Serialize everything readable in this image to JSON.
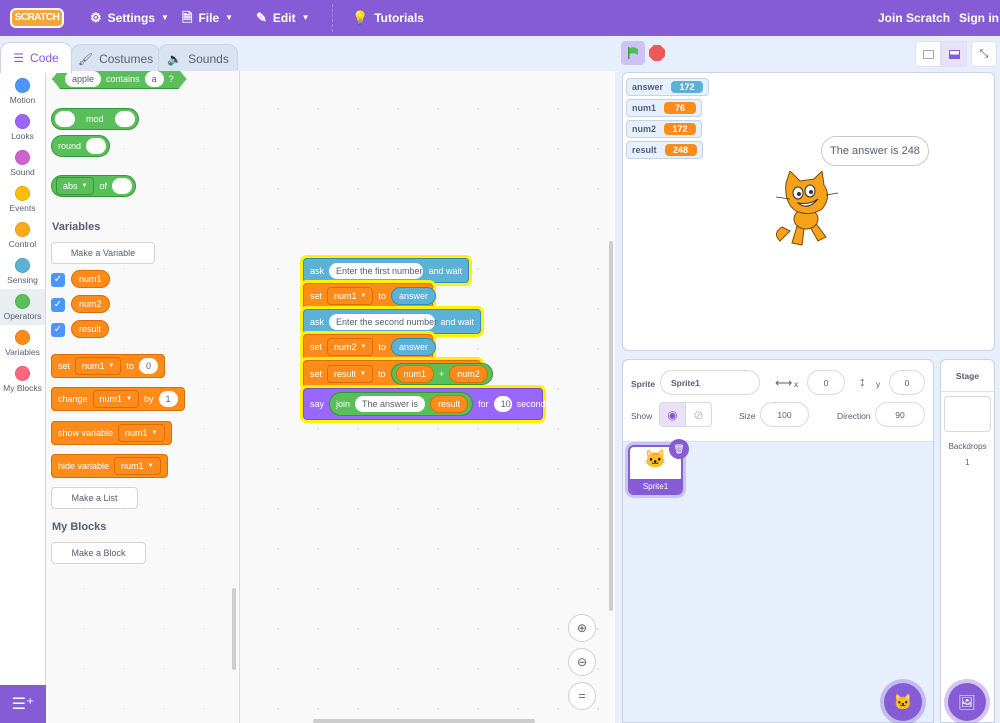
{
  "menubar": {
    "logo": "SCRATCH",
    "settings": "Settings",
    "file": "File",
    "edit": "Edit",
    "tutorials": "Tutorials",
    "join": "Join Scratch",
    "signin": "Sign in"
  },
  "tabs": [
    {
      "label": "Code",
      "active": true
    },
    {
      "label": "Costumes"
    },
    {
      "label": "Sounds"
    }
  ],
  "categories": [
    {
      "label": "Motion",
      "color": "#4c97ff"
    },
    {
      "label": "Looks",
      "color": "#9966ff"
    },
    {
      "label": "Sound",
      "color": "#cf63cf"
    },
    {
      "label": "Events",
      "color": "#ffbf00"
    },
    {
      "label": "Control",
      "color": "#ffab19"
    },
    {
      "label": "Sensing",
      "color": "#5cb1d6"
    },
    {
      "label": "Operators",
      "color": "#59c059"
    },
    {
      "label": "Variables",
      "color": "#ff8c1a"
    },
    {
      "label": "My Blocks",
      "color": "#ff6680"
    }
  ],
  "palette": {
    "contains": {
      "a": "apple",
      "word": "contains",
      "b": "a",
      "q": "?"
    },
    "mod": "mod",
    "round": "round",
    "abs": {
      "fn": "abs",
      "of": "of"
    },
    "variables_heading": "Variables",
    "make_variable": "Make a Variable",
    "vars": [
      "num1",
      "num2",
      "result"
    ],
    "set": {
      "word": "set",
      "var": "num1",
      "to": "to",
      "value": "0"
    },
    "change": {
      "word": "change",
      "var": "num1",
      "by": "by",
      "value": "1"
    },
    "show_variable": {
      "word": "show variable",
      "var": "num1"
    },
    "hide_variable": {
      "word": "hide variable",
      "var": "num1"
    },
    "make_list": "Make a List",
    "myblocks_heading": "My Blocks",
    "make_block": "Make a Block"
  },
  "script": {
    "ask1": {
      "word": "ask",
      "text": "Enter the first number",
      "tail": "and wait"
    },
    "set1": {
      "word": "set",
      "var": "num1",
      "to": "to",
      "value": "answer"
    },
    "ask2": {
      "word": "ask",
      "text": "Enter the second number",
      "tail": "and wait"
    },
    "set2": {
      "word": "set",
      "var": "num2",
      "to": "to",
      "value": "answer"
    },
    "set3": {
      "word": "set",
      "var": "result",
      "to": "to",
      "a": "num1",
      "op": "+",
      "b": "num2"
    },
    "say": {
      "word": "say",
      "join": "join",
      "text": "The answer is",
      "var": "result",
      "for": "for",
      "secs": "10",
      "unit": "seconds"
    }
  },
  "monitors": [
    {
      "name": "answer",
      "value": "172",
      "color": "#5cb1d6"
    },
    {
      "name": "num1",
      "value": "76",
      "color": "#ff8c1a"
    },
    {
      "name": "num2",
      "value": "172",
      "color": "#ff8c1a"
    },
    {
      "name": "result",
      "value": "248",
      "color": "#ff8c1a"
    }
  ],
  "speech": "The answer is 248",
  "sprite_info": {
    "sprite_label": "Sprite",
    "sprite_name": "Sprite1",
    "x_label": "x",
    "x": "0",
    "y_label": "y",
    "y": "0",
    "show_label": "Show",
    "size_label": "Size",
    "size": "100",
    "direction_label": "Direction",
    "direction": "90"
  },
  "sprites": [
    {
      "name": "Sprite1",
      "selected": true
    }
  ],
  "stage_panel": {
    "title": "Stage",
    "backdrops_label": "Backdrops",
    "backdrops_count": "1"
  }
}
